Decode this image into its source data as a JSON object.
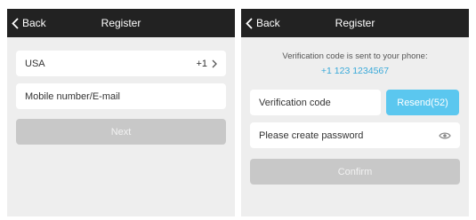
{
  "screen1": {
    "nav": {
      "back_label": "Back",
      "title": "Register"
    },
    "country": {
      "name": "USA",
      "code": "+1"
    },
    "contact_input": {
      "placeholder": "Mobile number/E-mail"
    },
    "next_label": "Next"
  },
  "screen2": {
    "nav": {
      "back_label": "Back",
      "title": "Register"
    },
    "info_text": "Verification code is sent to your phone:",
    "phone_number": "+1 123 1234567",
    "code_input": {
      "placeholder": "Verification code"
    },
    "resend_label": "Resend(52)",
    "password_input": {
      "placeholder": "Please create password"
    },
    "confirm_label": "Confirm"
  },
  "colors": {
    "nav_bg": "#222222",
    "accent": "#5bc7ef",
    "link": "#39a9d9",
    "disabled_button": "#c8c8c8",
    "screen_bg": "#eeeeee"
  },
  "icons": [
    "chevron-left-icon",
    "chevron-right-icon",
    "eye-icon"
  ]
}
